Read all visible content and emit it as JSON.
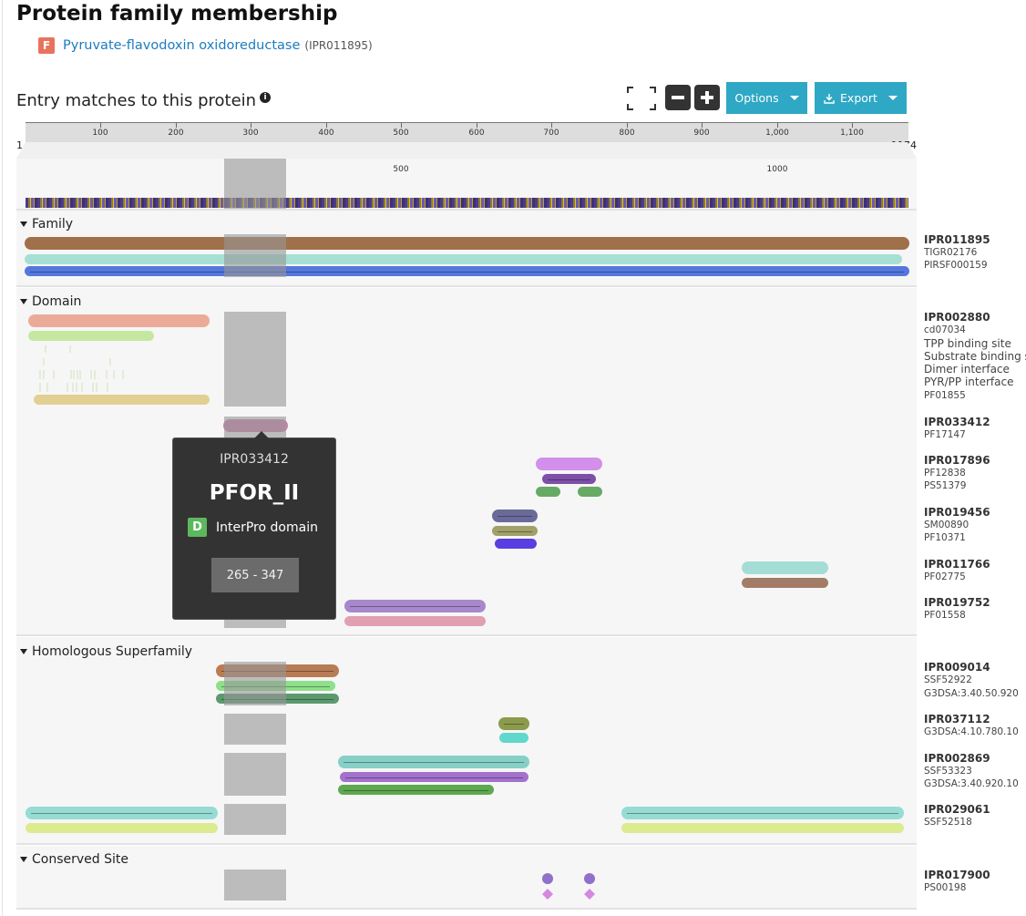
{
  "page": {
    "title": "Protein family membership",
    "family": {
      "badge": "F",
      "name": "Pyruvate-flavodoxin oxidoreductase",
      "accession": "(IPR011895)"
    }
  },
  "viewer": {
    "title": "Entry matches to this protein",
    "info_icon": "i",
    "buttons": {
      "options": "Options",
      "export": "Export"
    },
    "ruler": {
      "start": "1",
      "end": "1174",
      "ticks": [
        "100",
        "200",
        "300",
        "400",
        "500",
        "600",
        "700",
        "800",
        "900",
        "1,000",
        "1,100"
      ],
      "overview_ticks": [
        "500",
        "1000"
      ]
    },
    "sections": {
      "family": "Family",
      "domain": "Domain",
      "homologous": "Homologous Superfamily",
      "conserved": "Conserved Site"
    },
    "labels": {
      "ipr011895": {
        "main": "IPR011895",
        "subs": [
          "TIGR02176",
          "PIRSF000159"
        ]
      },
      "ipr002880": {
        "main": "IPR002880",
        "subs": [
          "cd07034",
          "TPP binding site",
          "Substrate binding si",
          "Dimer interface",
          "PYR/PP interface",
          "PF01855"
        ]
      },
      "ipr033412": {
        "main": "IPR033412",
        "subs": [
          "PF17147"
        ]
      },
      "ipr017896": {
        "main": "IPR017896",
        "subs": [
          "PF12838",
          "PS51379"
        ]
      },
      "ipr019456": {
        "main": "IPR019456",
        "subs": [
          "SM00890",
          "PF10371"
        ]
      },
      "ipr011766": {
        "main": "IPR011766",
        "subs": [
          "PF02775"
        ]
      },
      "ipr019752": {
        "main": "IPR019752",
        "subs": [
          "PF01558"
        ]
      },
      "ipr009014": {
        "main": "IPR009014",
        "subs": [
          "SSF52922",
          "G3DSA:3.40.50.920"
        ]
      },
      "ipr037112": {
        "main": "IPR037112",
        "subs": [
          "G3DSA:4.10.780.10"
        ]
      },
      "ipr002869": {
        "main": "IPR002869",
        "subs": [
          "SSF53323",
          "G3DSA:3.40.920.10"
        ]
      },
      "ipr029061": {
        "main": "IPR029061",
        "subs": [
          "SSF52518"
        ]
      },
      "ipr017900": {
        "main": "IPR017900",
        "subs": [
          "PS00198"
        ]
      }
    },
    "tooltip": {
      "accession": "IPR033412",
      "name": "PFOR_II",
      "type_badge": "D",
      "type": "InterPro domain",
      "range": "265 - 347"
    }
  },
  "colors": {
    "family_badge": "#e8735c",
    "domain_badge": "#5cb85c",
    "toolbar_button": "#2ea8c4",
    "link": "#1d7cbf"
  }
}
